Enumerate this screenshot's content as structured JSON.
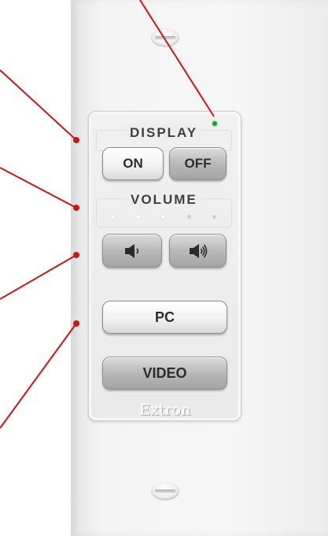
{
  "keypad": {
    "display_label": "DISPLAY",
    "volume_label": "VOLUME",
    "buttons": {
      "on": "ON",
      "off": "OFF",
      "volume_down_icon": "speaker-low-icon",
      "volume_up_icon": "speaker-high-icon",
      "pc": "PC",
      "video": "VIDEO"
    },
    "volume_level_leds": {
      "lit": 3,
      "total": 5
    },
    "power_led_color": "#1f9b3a"
  },
  "brand": {
    "logo": "Extron"
  },
  "callouts": {
    "count": 5,
    "color": "#cc1518"
  }
}
